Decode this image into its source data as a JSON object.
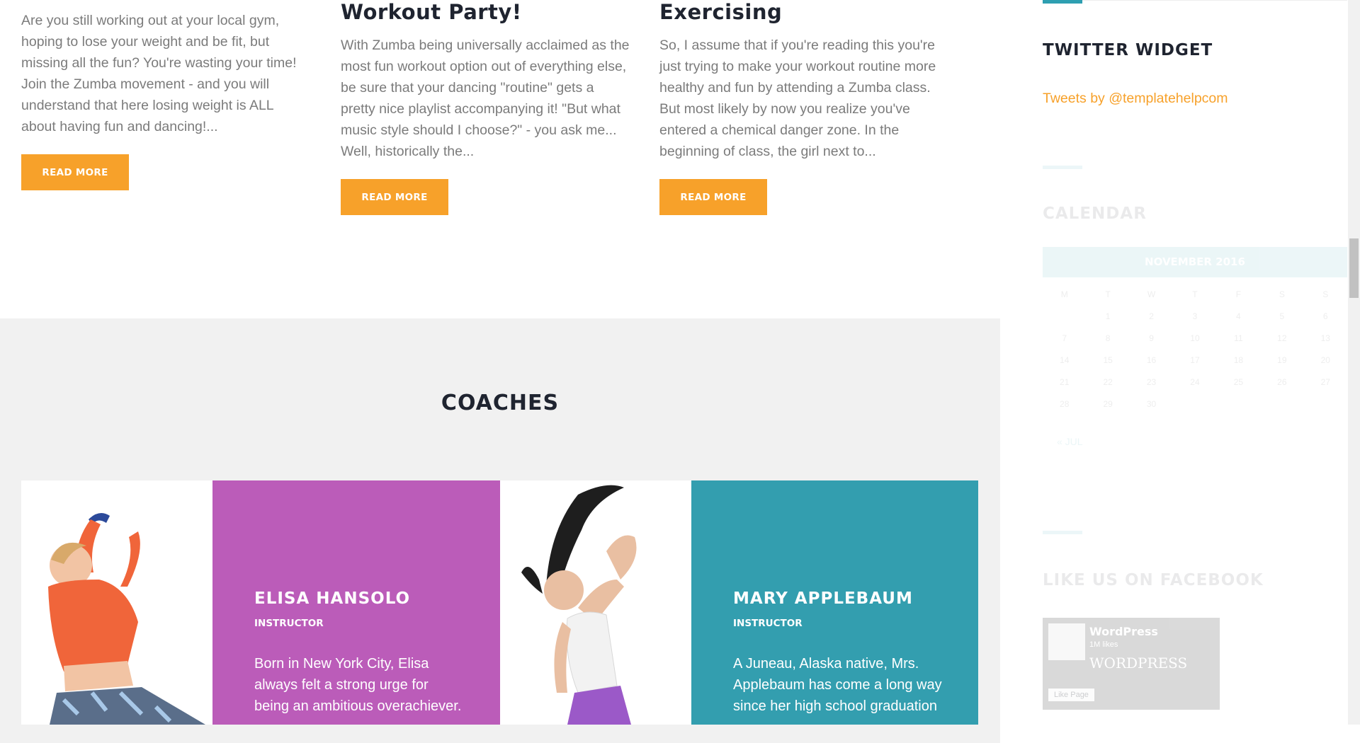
{
  "posts": [
    {
      "title": "",
      "excerpt": "Are you still working out at your local gym, hoping to lose your weight and be fit, but missing all the fun? You're wasting your time! Join the Zumba movement - and you will understand that here losing weight is ALL about having fun and dancing!...",
      "read_more": "READ MORE"
    },
    {
      "title": "Workout Party!",
      "excerpt": "With Zumba being universally acclaimed as the most fun workout option out of everything else, be sure that your dancing \"routine\" gets a pretty nice playlist accompanying it! \"But what music style should I choose?\" - you ask me... Well, historically the...",
      "read_more": "READ MORE"
    },
    {
      "title": "Exercising",
      "excerpt": "So, I assume that if you're reading this you're just trying to make your workout routine more healthy and fun by attending a Zumba class. But most likely by now you realize you've entered a chemical danger zone. In the beginning of class, the girl next to...",
      "read_more": "READ MORE"
    }
  ],
  "coaches": {
    "title": "COACHES",
    "items": [
      {
        "name": "ELISA HANSOLO",
        "role": "INSTRUCTOR",
        "bio": "Born in New York City, Elisa always felt a strong urge for being an ambitious overachiever.",
        "color": "#bb5cb9"
      },
      {
        "name": "MARY APPLEBAUM",
        "role": "INSTRUCTOR",
        "bio": "A Juneau, Alaska native, Mrs. Applebaum has come a long way since her high school graduation",
        "color": "#339eaf"
      }
    ]
  },
  "sidebar": {
    "twitter": {
      "title": "TWITTER WIDGET",
      "link": "Tweets by @templatehelpcom",
      "link_color": "#f7a12a"
    },
    "calendar": {
      "title": "CALENDAR",
      "month": "NOVEMBER 2016",
      "weekdays": [
        "M",
        "T",
        "W",
        "T",
        "F",
        "S",
        "S"
      ],
      "weeks": [
        [
          "",
          "1",
          "2",
          "3",
          "4",
          "5",
          "6"
        ],
        [
          "7",
          "8",
          "9",
          "10",
          "11",
          "12",
          "13"
        ],
        [
          "14",
          "15",
          "16",
          "17",
          "18",
          "19",
          "20"
        ],
        [
          "21",
          "22",
          "23",
          "24",
          "25",
          "26",
          "27"
        ],
        [
          "28",
          "29",
          "30",
          "",
          "",
          "",
          ""
        ]
      ],
      "prev": "« JUL"
    },
    "facebook": {
      "title": "LIKE US ON FACEBOOK",
      "page_name": "WordPress",
      "likes": "1M likes",
      "brand": "WORDPRESS",
      "like_button": "Like Page"
    }
  },
  "colors": {
    "accent": "#f7a12a",
    "teal": "#2e9fb1",
    "purple": "#bb5cb9",
    "heading": "#1f2430"
  }
}
